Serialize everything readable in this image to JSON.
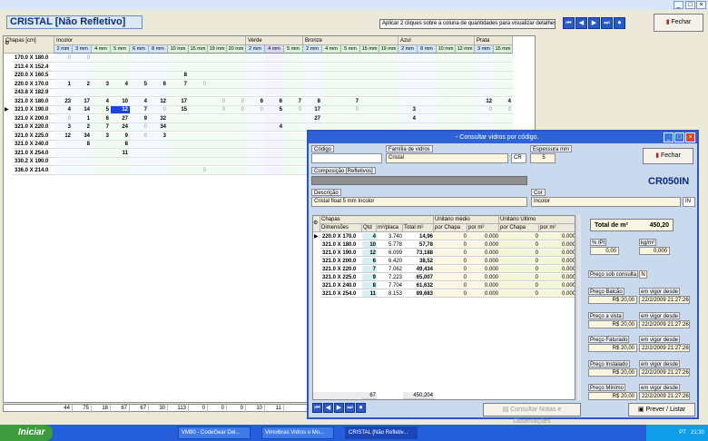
{
  "main": {
    "title": "CRISTAL [Não Refletivo]",
    "hint": "Aplicar 2 cliques sobre a coluna de quantidades para visualizar detalhes",
    "close": "Fechar",
    "nav": [
      "⏮",
      "◀",
      "▶",
      "⏭",
      "⏺"
    ]
  },
  "grid": {
    "corner": "Chapas [cm]",
    "groups": [
      "Incolor",
      "Verde",
      "Bronze",
      "Azul",
      "Prata"
    ],
    "subs": [
      "2 mm",
      "3 mm",
      "4 mm",
      "5 mm",
      "6 mm",
      "8 mm",
      "10 mm",
      "15 mm",
      "19 mm",
      "20 mm",
      "2 mm",
      "4 mm",
      "5 mm",
      "2 mm",
      "4 mm",
      "5 mm",
      "15 mm",
      "19 mm",
      "2 mm",
      "8 mm",
      "10 mm",
      "12 mm",
      "3 mm",
      "15 mm"
    ],
    "rows": [
      {
        "label": "170.0 X 180.0",
        "cells": [
          "0",
          "0",
          "",
          "",
          "",
          "",
          "",
          "",
          "",
          "",
          "",
          "",
          "",
          "",
          "",
          "",
          "",
          "",
          "",
          "",
          "",
          "",
          "",
          ""
        ]
      },
      {
        "label": "213.4 X 152.4",
        "cells": [
          "",
          "",
          "",
          "",
          "",
          "",
          "",
          "",
          "",
          "",
          "",
          "",
          "",
          "",
          "",
          "",
          "",
          "",
          "",
          "",
          "",
          "",
          "",
          ""
        ]
      },
      {
        "label": "220.0 X 160.5",
        "cells": [
          "",
          "",
          "",
          "",
          "",
          "",
          "8",
          "",
          "",
          "",
          "",
          "",
          "",
          "",
          "",
          "",
          "",
          "",
          "",
          "",
          "",
          "",
          "",
          ""
        ]
      },
      {
        "label": "220.0 X 170.0",
        "cells": [
          "1",
          "2",
          "3",
          "4",
          "5",
          "6",
          "7",
          "0",
          "",
          "",
          "",
          "",
          "",
          "",
          "",
          "",
          "",
          "",
          "",
          "",
          "",
          "",
          "",
          ""
        ]
      },
      {
        "label": "243.8 X 182.9",
        "cells": [
          "",
          "",
          "",
          "",
          "",
          "",
          "",
          "",
          "",
          "",
          "",
          "",
          "",
          "",
          "",
          "",
          "",
          "",
          "",
          "",
          "",
          "",
          "",
          ""
        ]
      },
      {
        "label": "321.0 X 180.0",
        "cells": [
          "23",
          "17",
          "4",
          "10",
          "4",
          "12",
          "17",
          "",
          "0",
          "0",
          "6",
          "6",
          "7",
          "8",
          "",
          "7",
          "",
          "",
          "",
          "",
          "",
          "",
          "12",
          "4"
        ]
      },
      {
        "label": "321.0 X 190.0",
        "cells": [
          "4",
          "14",
          "5",
          "12",
          "7",
          "0",
          "15",
          "",
          "0",
          "0",
          "0",
          "5",
          "0",
          "17",
          "",
          "0",
          "",
          "",
          "3",
          "",
          "",
          "",
          "0",
          "0"
        ]
      },
      {
        "label": "321.0 X 200.0",
        "cells": [
          "0",
          "1",
          "6",
          "27",
          "9",
          "32",
          "",
          "",
          "",
          "",
          "",
          "",
          "",
          "27",
          "",
          "",
          "",
          "",
          "4",
          "",
          "",
          "",
          "",
          ""
        ]
      },
      {
        "label": "321.0 X 220.0",
        "cells": [
          "3",
          "2",
          "7",
          "24",
          "0",
          "34",
          "",
          "",
          "",
          "",
          "",
          "4",
          "",
          "",
          "",
          "",
          "",
          "",
          "",
          "",
          "",
          "",
          "",
          ""
        ]
      },
      {
        "label": "321.0 X 225.0",
        "cells": [
          "12",
          "34",
          "3",
          "9",
          "0",
          "3",
          "",
          "",
          "",
          "",
          "",
          "",
          "",
          "",
          "",
          "",
          "",
          "",
          "",
          "",
          "",
          "",
          "",
          ""
        ]
      },
      {
        "label": "321.0 X 240.0",
        "cells": [
          "",
          "8",
          "",
          "8",
          "",
          "",
          "",
          "",
          "",
          "",
          "",
          "",
          "",
          "",
          "",
          "",
          "",
          "",
          "",
          "",
          "",
          "",
          "",
          ""
        ]
      },
      {
        "label": "321.0 X 254.0",
        "cells": [
          "",
          "",
          "",
          "11",
          "",
          "",
          "",
          "",
          "",
          "",
          "",
          "",
          "",
          "",
          "",
          "",
          "",
          "",
          "",
          "",
          "",
          "",
          "",
          ""
        ]
      },
      {
        "label": "330.2 X 190.0",
        "cells": [
          "",
          "",
          "",
          "",
          "",
          "",
          "",
          "",
          "",
          "",
          "",
          "",
          "",
          "",
          "",
          "",
          "",
          "",
          "",
          "",
          "",
          "",
          "",
          ""
        ]
      },
      {
        "label": "336.0 X 214.0",
        "cells": [
          "",
          "",
          "",
          "",
          "",
          "",
          "",
          "0",
          "",
          "",
          "",
          "",
          "",
          "",
          "",
          "",
          "",
          "",
          "",
          "",
          "",
          "",
          "",
          ""
        ]
      }
    ],
    "totals": [
      "44",
      "75",
      "18",
      "67",
      "67",
      "30",
      "113",
      "0",
      "0",
      "0",
      "10",
      "11"
    ]
  },
  "dialog": {
    "title": "- Consultar vidros por código.",
    "codigo_label": "Código",
    "codigo_value": "",
    "familia_label": "Família de vidros",
    "familia_value": "Cristal",
    "familia_code": "CR",
    "espessura_label": "Espessura mm",
    "espessura_value": "5",
    "fechar": "Fechar",
    "composicao_label": "Composição [Refletivos]",
    "product_code": "CR050IN",
    "descricao_label": "Descrição",
    "descricao_value": "Cristal float 5 mm Incolor",
    "cor_label": "Cor",
    "cor_value": "Incolor",
    "cor_code": "IN",
    "grid_headers": {
      "chapas": "Chapas",
      "dimensoes": "Dimensões",
      "qtd": "Qtd",
      "m2placa": "m²/placa",
      "total": "Total m²",
      "unit_medio": "Unitário médio",
      "unit_ultimo": "Unitário Último",
      "por_chapa": "por Chapa",
      "por_m2": "por m²"
    },
    "rows": [
      {
        "dim": "220.0 X 170.0",
        "qtd": "4",
        "m2": "3.740",
        "total": "14,96",
        "c1": "0",
        "c2": "0.000",
        "c3": "0.000"
      },
      {
        "dim": "321.0 X 180.0",
        "qtd": "10",
        "m2": "5.778",
        "total": "57,78",
        "c1": "0",
        "c2": "0.000",
        "c3": "0.000"
      },
      {
        "dim": "321.0 X 190.0",
        "qtd": "12",
        "m2": "6.099",
        "total": "73,188",
        "c1": "0",
        "c2": "0.000",
        "c3": "0.000"
      },
      {
        "dim": "321.0 X 200.0",
        "qtd": "6",
        "m2": "6.420",
        "total": "38,52",
        "c1": "0",
        "c2": "0.000",
        "c3": "0.000"
      },
      {
        "dim": "321.0 X 220.0",
        "qtd": "7",
        "m2": "7.062",
        "total": "49,434",
        "c1": "0",
        "c2": "0.000",
        "c3": "0.000"
      },
      {
        "dim": "321.0 X 225.0",
        "qtd": "9",
        "m2": "7.223",
        "total": "65,007",
        "c1": "0",
        "c2": "0.000",
        "c3": "0.000"
      },
      {
        "dim": "321.0 X 240.0",
        "qtd": "8",
        "m2": "7.704",
        "total": "61,632",
        "c1": "0",
        "c2": "0.000",
        "c3": "0.000"
      },
      {
        "dim": "321.0 X 254.0",
        "qtd": "11",
        "m2": "8.153",
        "total": "89,683",
        "c1": "0",
        "c2": "0.000",
        "c3": "0.000"
      }
    ],
    "total_qtd": "67",
    "total_m2": "450,204",
    "total_m2_label": "Total de m²",
    "total_m2_value": "450,20",
    "ipi_label": "% IPI",
    "ipi_value": "0,00",
    "kg_label": "kg/m²",
    "kg_value": "0,000",
    "sob_consulta_label": "Preço sob consulta",
    "sob_consulta_value": "N",
    "prices": [
      {
        "label": "Preço Balcão",
        "value": "R$ 20,00",
        "vig": "em vigor desde",
        "date": "22/2/2009 21:27:26"
      },
      {
        "label": "Preço a vista",
        "value": "R$ 20,00",
        "vig": "em vigor desde",
        "date": "22/2/2009 21:27:26"
      },
      {
        "label": "Preço Faturado",
        "value": "R$ 20,00",
        "vig": "em vigor desde",
        "date": "22/2/2009 21:27:26"
      },
      {
        "label": "Preço Instalado",
        "value": "R$ 20,00",
        "vig": "em vigor desde",
        "date": "22/2/2009 21:27:26"
      },
      {
        "label": "Preço Mínimo",
        "value": "R$ 20,00",
        "vig": "em vigor desde",
        "date": "22/2/2009 21:27:26"
      }
    ],
    "consultar_notas": "Consultar Notas e Observações",
    "prever": "Prever / Listar"
  },
  "taskbar": {
    "start": "Iniciar",
    "items": [
      "VM80 - CodeGear Del...",
      "Vimolbras Vidros e Mo...",
      "CRISTAL [Não Refletiv..."
    ],
    "lang": "PT",
    "time": "21:30"
  }
}
